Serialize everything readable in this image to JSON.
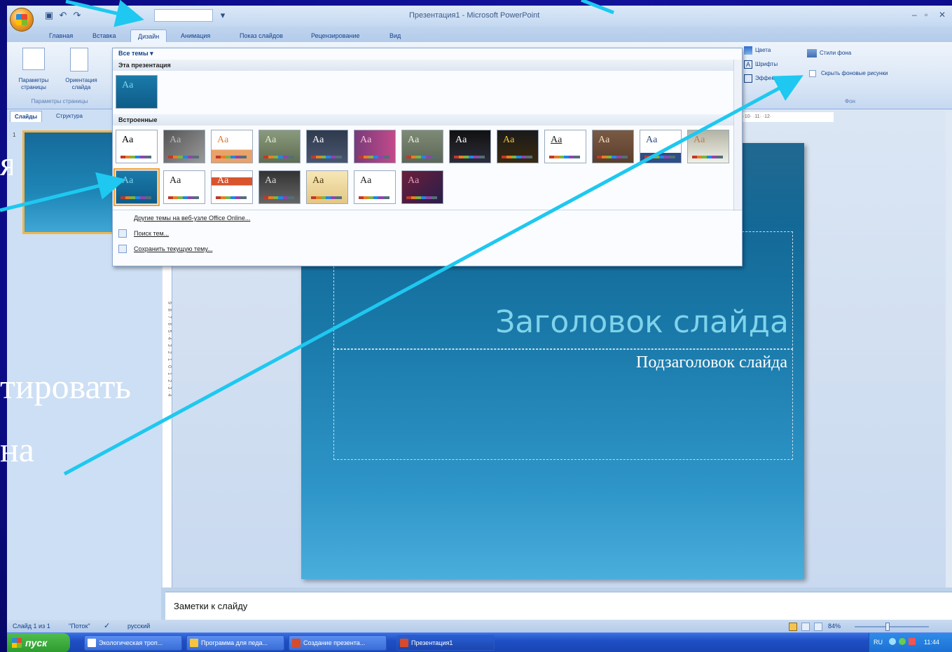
{
  "window": {
    "title": "Презентация1 - Microsoft PowerPoint",
    "controls": [
      "–",
      "▫",
      "✕"
    ]
  },
  "quick_access": {
    "save_icon": "save-icon",
    "undo_icon": "undo-icon",
    "redo_icon": "redo-icon"
  },
  "tabs": [
    {
      "label": "Главная"
    },
    {
      "label": "Вставка"
    },
    {
      "label": "Дизайн"
    },
    {
      "label": "Анимация"
    },
    {
      "label": "Показ слайдов"
    },
    {
      "label": "Рецензирование"
    },
    {
      "label": "Вид"
    }
  ],
  "ribbon": {
    "page_setup_label": "Параметры страницы",
    "orientation_label": "Ориентация слайда",
    "group_page_setup": "Параметры страницы",
    "colors_label": "Цвета",
    "fonts_label": "Шрифты",
    "effects_label": "Эффекты",
    "bg_styles_label": "Стили фона",
    "hide_bg_label": "Скрыть фоновые рисунки",
    "group_background": "Фон"
  },
  "panel": {
    "tab_slides": "Слайды",
    "tab_outline": "Структура",
    "thumb_number": "1"
  },
  "ruler": {
    "horizontal": "·9· ·10· ·11· ·12·",
    "vertical": "9 · 8 · 7 · 6 · 5 · 4 · 3 · 2 · 1 · 0 · 1 · 2 · 3 · 4"
  },
  "gallery": {
    "top_label": "Все темы ▾",
    "section_this": "Эта презентация",
    "section_builtin": "Встроенные",
    "menu": [
      {
        "label": "Другие темы на веб-узле Office Online..."
      },
      {
        "label": "Поиск тем..."
      },
      {
        "label": "Сохранить текущую тему..."
      }
    ],
    "theme_sample": "Aa"
  },
  "slide": {
    "title": "Заголовок слайда",
    "subtitle": "Подзаголовок слайда"
  },
  "notes": {
    "placeholder": "Заметки к слайду"
  },
  "status": {
    "slide_of": "Слайд 1 из 1",
    "theme": "\"Поток\"",
    "language": "русский",
    "zoom": "84%"
  },
  "overlay_words": {
    "w1": "я",
    "w2": "тировать",
    "w3": "на"
  },
  "taskbar": {
    "start": "пуск",
    "tasks": [
      {
        "label": "Экологическая троп..."
      },
      {
        "label": "Программа для педа..."
      },
      {
        "label": "Создание презента..."
      },
      {
        "label": "Презентация1"
      }
    ],
    "lang": "RU",
    "time": "11:44"
  },
  "colors": {
    "accent_arrow": "#1ec8f0",
    "slide_title": "#7fd3ea",
    "backdrop": "#0d0d8c"
  }
}
